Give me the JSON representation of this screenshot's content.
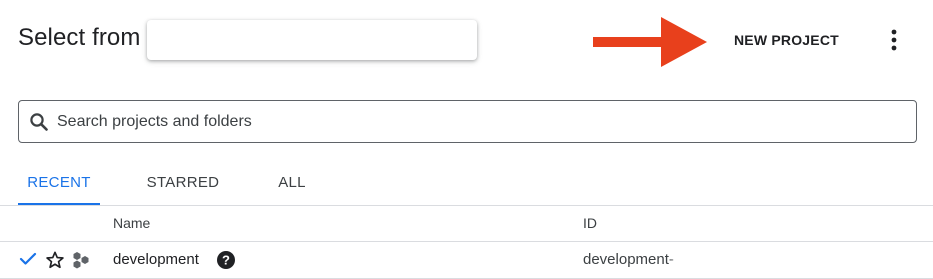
{
  "dialog": {
    "title": "Select from",
    "new_project_label": "NEW PROJECT",
    "more_options_icon": "more-vert-icon",
    "arrow_color": "#e8401c"
  },
  "search": {
    "placeholder": "Search projects and folders",
    "value": "",
    "icon": "search-icon"
  },
  "tabs": [
    {
      "label": "RECENT",
      "active": true
    },
    {
      "label": "STARRED",
      "active": false
    },
    {
      "label": "ALL",
      "active": false
    }
  ],
  "table": {
    "columns": [
      "Name",
      "ID"
    ],
    "rows": [
      {
        "selected": true,
        "starred": false,
        "type_icon": "project-icon",
        "name": "development",
        "id": "development-"
      }
    ]
  },
  "colors": {
    "accent": "#1a73e8",
    "text": "#202124",
    "divider": "#dadce0"
  }
}
